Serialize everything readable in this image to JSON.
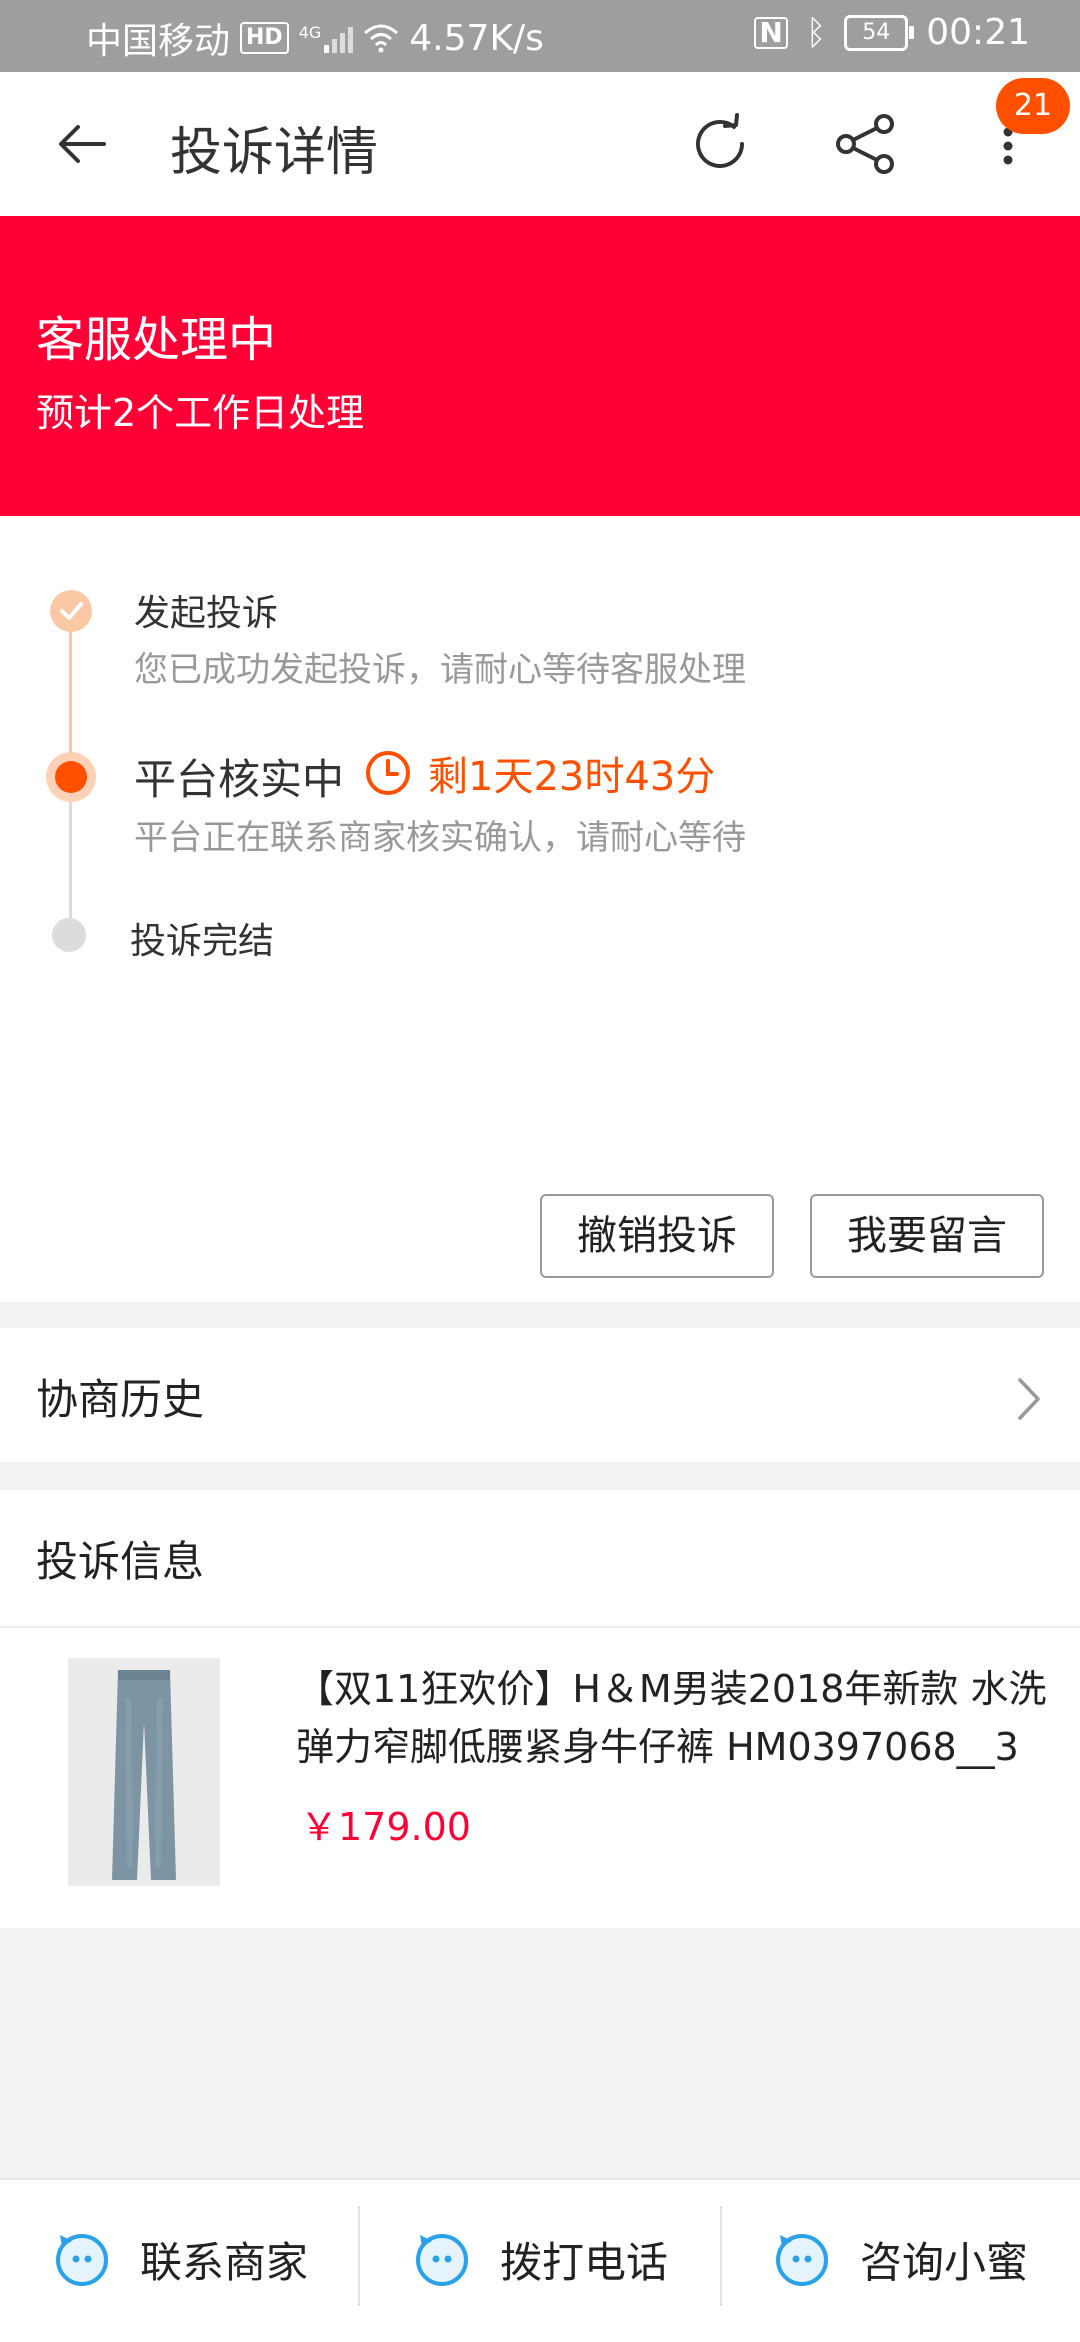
{
  "status_bar": {
    "carrier": "中国移动",
    "hd": "HD",
    "network": "4G",
    "speed": "4.57K/s",
    "battery": "54",
    "time": "00:21"
  },
  "header": {
    "title": "投诉详情",
    "badge_count": "21"
  },
  "banner": {
    "title": "客服处理中",
    "subtitle": "预计2个工作日处理",
    "color": "#ff0036"
  },
  "steps": [
    {
      "title": "发起投诉",
      "desc": "您已成功发起投诉，请耐心等待客服处理",
      "status": "done"
    },
    {
      "title": "平台核实中",
      "desc": "平台正在联系商家核实确认，请耐心等待",
      "status": "active",
      "timer": "剩1天23时43分"
    },
    {
      "title": "投诉完结",
      "status": "pending"
    }
  ],
  "actions": {
    "cancel": "撤销投诉",
    "message": "我要留言"
  },
  "history": {
    "label": "协商历史"
  },
  "complaint_info": {
    "label": "投诉信息",
    "product": {
      "title": "【双11狂欢价】H＆M男装2018年新款 水洗弹力窄脚低腰紧身牛仔裤 HM0397068__3",
      "price": "￥179.00"
    }
  },
  "bottom_bar": {
    "contact_merchant": "联系商家",
    "call": "拨打电话",
    "consult": "咨询小蜜"
  },
  "colors": {
    "accent": "#ff5000",
    "price": "#ff0036",
    "icon_blue": "#2aa1e8"
  }
}
